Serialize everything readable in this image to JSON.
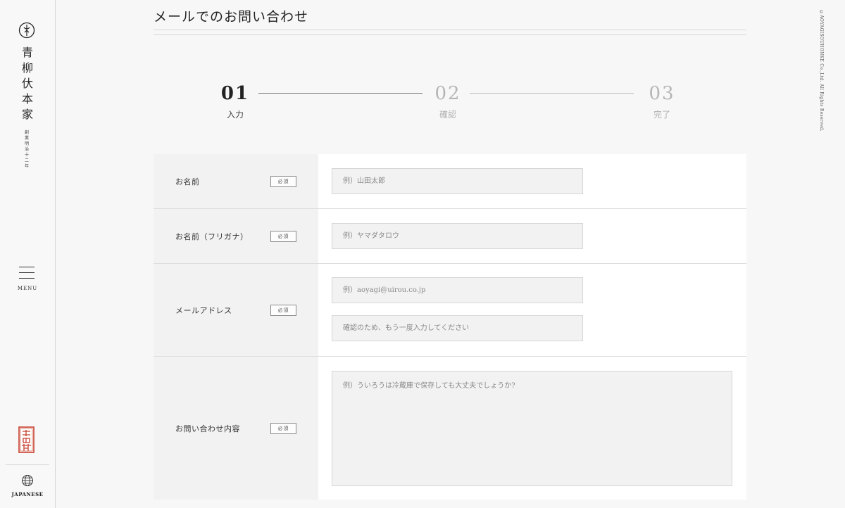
{
  "sidebar": {
    "logo_text": [
      "青",
      "柳",
      "㐲",
      "本",
      "家"
    ],
    "logo_sub": [
      "創",
      "業",
      "明",
      "治",
      "十",
      "二",
      "年"
    ],
    "menu_label": "MENU",
    "language_label": "JAPANESE"
  },
  "copyright": "©AOYAGISOUHONKE Co.,Ltd. All Rights Reserved.",
  "page": {
    "title": "メールでのお問い合わせ"
  },
  "steps": [
    {
      "num": "01",
      "label": "入力",
      "state": "active"
    },
    {
      "num": "02",
      "label": "確認",
      "state": "inactive"
    },
    {
      "num": "03",
      "label": "完了",
      "state": "inactive"
    }
  ],
  "form": {
    "required_label": "必須",
    "rows": [
      {
        "label": "お名前",
        "placeholder": "例）山田太郎"
      },
      {
        "label": "お名前（フリガナ）",
        "placeholder": "例）ヤマダタロウ"
      },
      {
        "label": "メールアドレス",
        "placeholder": "例）aoyagi@uirou.co.jp",
        "confirm_placeholder": "確認のため、もう一度入力してください"
      },
      {
        "label": "お問い合わせ内容",
        "placeholder": "例）ういろうは冷蔵庫で保存しても大丈夫でしょうか?"
      }
    ]
  },
  "colors": {
    "background": "#f7f7f7",
    "panel": "#ffffff",
    "label_bg": "#f2f2f2",
    "seal_red": "#c8402e",
    "active_step": "#222222",
    "inactive_step": "#b5b5b5"
  }
}
